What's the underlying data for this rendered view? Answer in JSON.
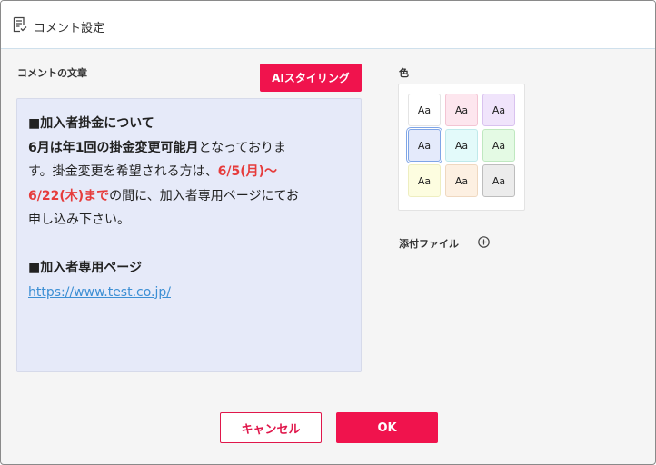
{
  "dialog": {
    "title": "コメント設定",
    "title_icon": "document-lines-icon"
  },
  "comment": {
    "label": "コメントの文章",
    "ai_button": "AIスタイリング",
    "heading1": "■加入者掛金について",
    "p1_bold": "6月は年1回の掛金変更可能月",
    "p1_normal": "となっておりま",
    "p2_normal": "す。掛金変更を希望される方は、",
    "p2_red": "6/5(月)〜",
    "p3_red": "6/22(木)まで",
    "p3_normal": "の間に、加入者専用ページにてお",
    "p4_normal": "申し込み下さい。",
    "heading2": "■加入者専用ページ",
    "link": "https://www.test.co.jp/"
  },
  "color": {
    "label": "色",
    "swatches": [
      {
        "label": "Aa",
        "bg": "#ffffff",
        "border": "#e4e4e4",
        "selected": false
      },
      {
        "label": "Aa",
        "bg": "#fde6ee",
        "border": "#f3c4d3",
        "selected": false
      },
      {
        "label": "Aa",
        "bg": "#f0e4fb",
        "border": "#d9c2ef",
        "selected": false
      },
      {
        "label": "Aa",
        "bg": "#e4eafb",
        "border": "#7fa5e6",
        "selected": true
      },
      {
        "label": "Aa",
        "bg": "#e3fafa",
        "border": "#bfe9ea",
        "selected": false
      },
      {
        "label": "Aa",
        "bg": "#e4fae4",
        "border": "#bfe8c0",
        "selected": false
      },
      {
        "label": "Aa",
        "bg": "#fdfde0",
        "border": "#eeeec0",
        "selected": false
      },
      {
        "label": "Aa",
        "bg": "#fdf0e2",
        "border": "#efd8c0",
        "selected": false
      },
      {
        "label": "Aa",
        "bg": "#ececec",
        "border": "#bdbdbd",
        "selected": false
      }
    ]
  },
  "attachment": {
    "label": "添付ファイル",
    "icon": "plus-circle-icon"
  },
  "footer": {
    "cancel": "キャンセル",
    "ok": "OK"
  },
  "colors": {
    "accent": "#f0134d",
    "red_text": "#e63c3c",
    "link": "#3c8fd4",
    "comment_bg": "#e6eaf9"
  }
}
